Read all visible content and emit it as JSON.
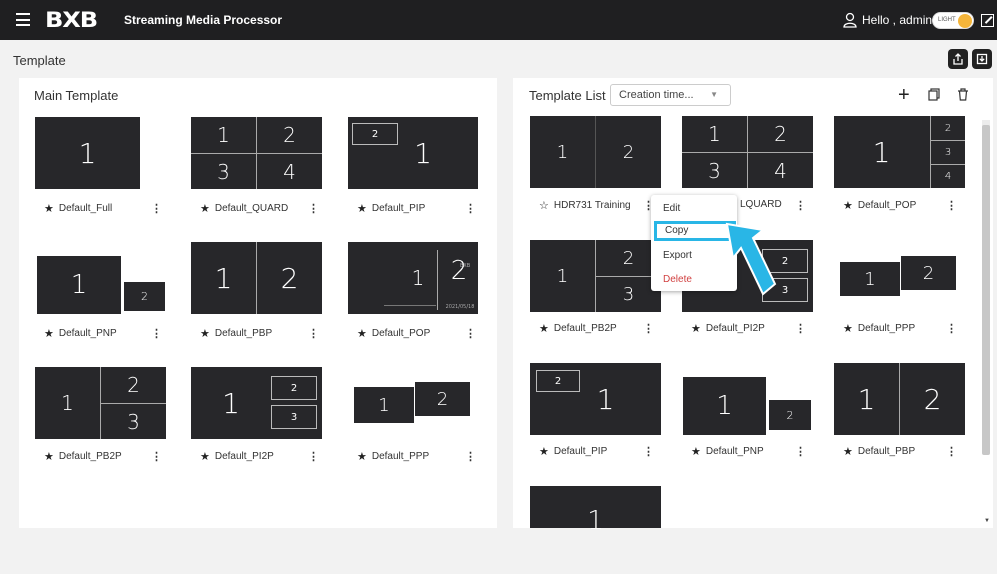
{
  "header": {
    "brand": "BXB",
    "app_title": "Streaming Media Processor",
    "greeting": "Hello , admin",
    "theme_label": "LIGHT"
  },
  "page": {
    "title": "Template"
  },
  "main_panel": {
    "title": "Main Template",
    "cards": [
      {
        "name": "Default_Full"
      },
      {
        "name": "Default_QUARD"
      },
      {
        "name": "Default_PIP"
      },
      {
        "name": "Default_PNP"
      },
      {
        "name": "Default_PBP"
      },
      {
        "name": "Default_POP"
      },
      {
        "name": "Default_PB2P"
      },
      {
        "name": "Default_PI2P"
      },
      {
        "name": "Default_PPP"
      }
    ],
    "pop_overlay": {
      "brand": "BXB",
      "date": "2021/05/18"
    }
  },
  "list_panel": {
    "title": "Template List",
    "sort_value": "Creation time...",
    "cards": [
      {
        "name": "HDR731 Training"
      },
      {
        "name": "LQUARD"
      },
      {
        "name": "Default_POP"
      },
      {
        "name": "Default_PB2P"
      },
      {
        "name": "Default_PI2P"
      },
      {
        "name": "Default_PPP"
      },
      {
        "name": "Default_PIP"
      },
      {
        "name": "Default_PNP"
      },
      {
        "name": "Default_PBP"
      }
    ]
  },
  "context_menu": {
    "items": [
      "Edit",
      "Copy",
      "Export",
      "Delete"
    ]
  },
  "icons": {
    "menu": "hamburger-icon",
    "user": "user-icon",
    "fullscreen": "fullscreen-icon",
    "export": "upload-icon",
    "import": "download-icon",
    "add": "plus-icon",
    "copy": "copy-icon",
    "delete": "trash-icon",
    "star": "star-icon",
    "more": "kebab-icon"
  },
  "colors": {
    "topbar": "#1f1f21",
    "thumb": "#27272a",
    "highlight": "#29b6e6",
    "delete": "#d14040",
    "toggle_knob": "#f5b53a"
  }
}
